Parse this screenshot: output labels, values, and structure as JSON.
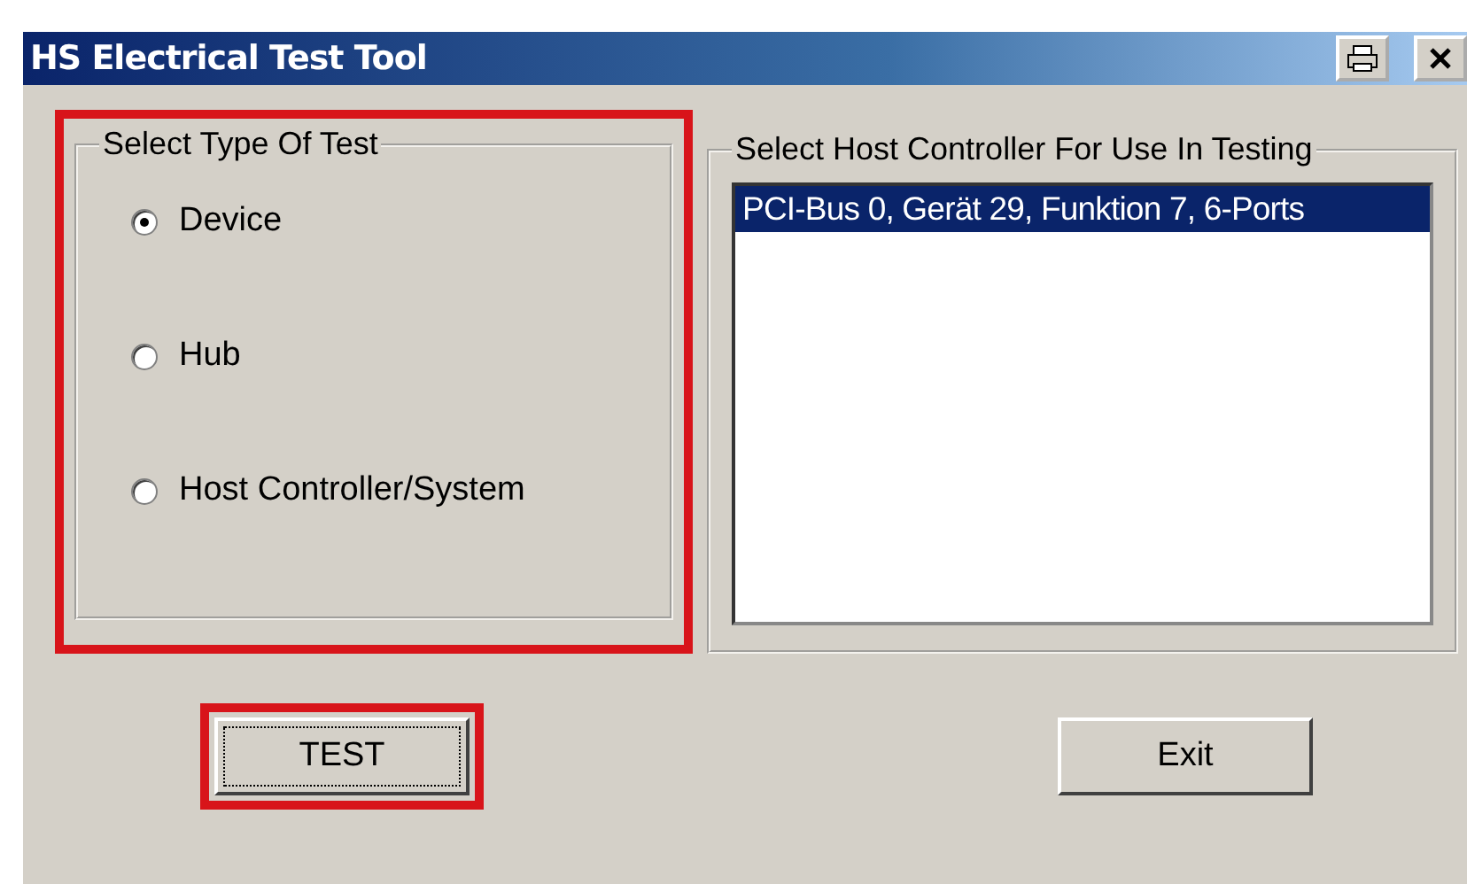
{
  "window": {
    "title": "HS Electrical Test Tool"
  },
  "test_type": {
    "title": "Select Type Of Test",
    "highlighted": true,
    "options": [
      {
        "label": "Device",
        "selected": true
      },
      {
        "label": "Hub",
        "selected": false
      },
      {
        "label": "Host Controller/System",
        "selected": false
      }
    ]
  },
  "host_controller": {
    "title": "Select Host Controller For Use In Testing",
    "items": [
      {
        "label": "PCI-Bus 0, Gerät 29, Funktion 7, 6-Ports",
        "selected": true
      }
    ]
  },
  "buttons": [
    {
      "label": "TEST",
      "highlighted": true,
      "focused": true
    },
    {
      "label": "Exit",
      "highlighted": false,
      "focused": false
    }
  ]
}
